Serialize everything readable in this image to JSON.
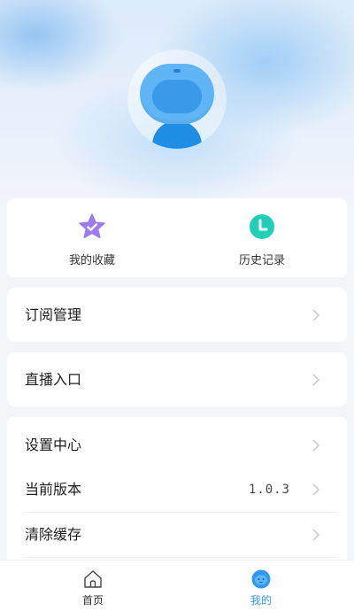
{
  "quick": [
    {
      "label": "我的收藏",
      "icon": "star-badge-icon"
    },
    {
      "label": "历史记录",
      "icon": "history-clock-icon"
    }
  ],
  "menu": {
    "subscription": "订阅管理",
    "live": "直播入口",
    "settings": "设置中心",
    "version_label": "当前版本",
    "version_value": "1.0.3",
    "clear_cache": "清除缓存"
  },
  "tabbar": {
    "home": "首页",
    "mine": "我的"
  },
  "colors": {
    "accent": "#2f9bf0",
    "star": "#9c7cf0",
    "clock": "#1fcfb7"
  }
}
